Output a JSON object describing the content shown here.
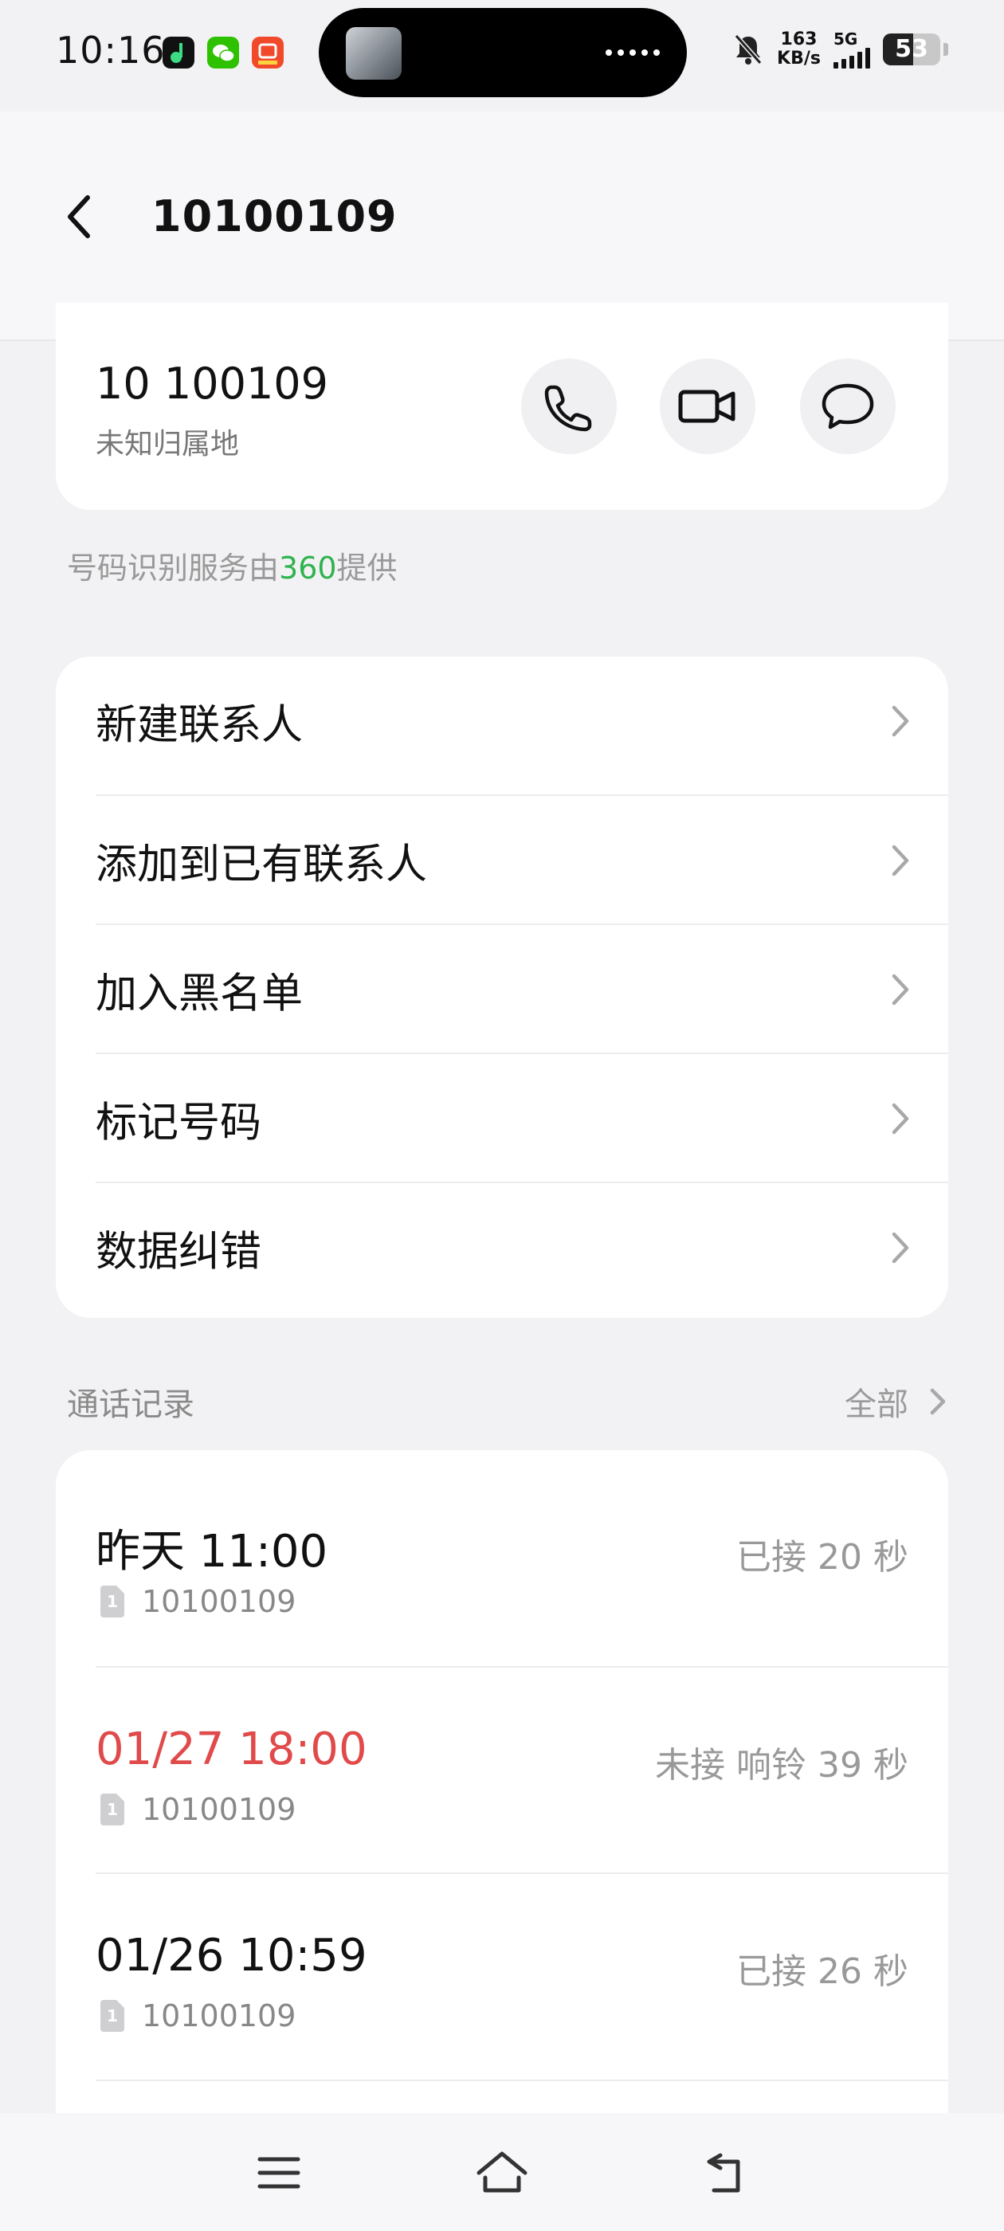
{
  "status_bar": {
    "time": "10:16",
    "net_speed_value": "163",
    "net_speed_unit": "KB/s",
    "network_type": "5G",
    "battery": "53",
    "battery_level_percent": 53,
    "icons": [
      "music-app-icon",
      "wechat-icon",
      "shopping-app-icon",
      "mute-bell-icon",
      "signal-icon",
      "battery-icon"
    ]
  },
  "header": {
    "title": "10100109"
  },
  "contact": {
    "number": "10 100109",
    "location": "未知归属地"
  },
  "service": {
    "prefix": "号码识别服务由",
    "provider": "360",
    "suffix": "提供",
    "provider_color": "#2fb34f"
  },
  "menu": {
    "items": [
      {
        "label": "新建联系人"
      },
      {
        "label": "添加到已有联系人"
      },
      {
        "label": "加入黑名单"
      },
      {
        "label": "标记号码"
      },
      {
        "label": "数据纠错"
      }
    ]
  },
  "records": {
    "title": "通话记录",
    "all_label": "全部",
    "items": [
      {
        "time": "昨天 11:00",
        "sim": "1",
        "number": "10100109",
        "status": "已接 20 秒"
      },
      {
        "time": "01/27 18:00",
        "sim": "1",
        "number": "10100109",
        "status": "未接  响铃 39 秒"
      },
      {
        "time": "01/26 10:59",
        "sim": "1",
        "number": "10100109",
        "status": "已接 26 秒"
      }
    ],
    "missed_color": "#e04a4a"
  }
}
